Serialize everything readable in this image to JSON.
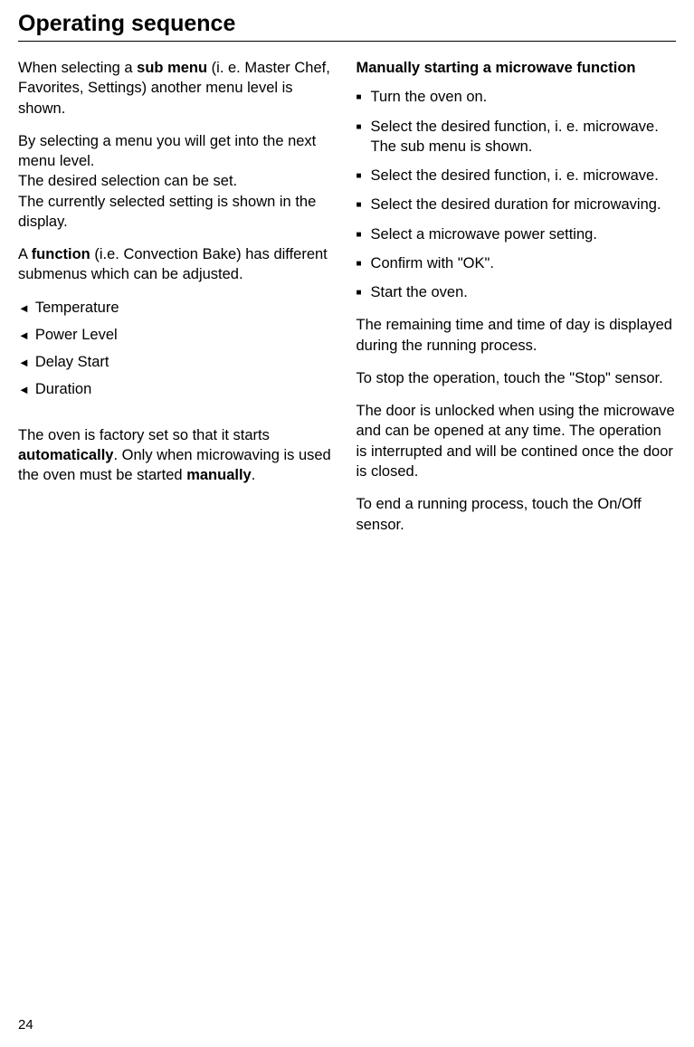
{
  "page": {
    "title": "Operating sequence",
    "number": "24"
  },
  "left": {
    "p1_a": "When selecting a ",
    "p1_bold": "sub menu",
    "p1_b": " (i. e. Master Chef, Favorites, Settings) another menu level is shown.",
    "p2": "By selecting a menu you will get into the next menu level.\nThe desired selection can be set.\nThe currently selected setting is shown in the display.",
    "p3_a": "A ",
    "p3_bold": "function",
    "p3_b": " (i.e. Convection Bake) has different submenus which can be adjusted.",
    "submenus": [
      "Temperature",
      "Power Level",
      "Delay Start",
      "Duration"
    ],
    "p4_a": "The oven is factory set so that it starts ",
    "p4_bold1": "automatically",
    "p4_b": ". Only when microwaving is used the oven must be started ",
    "p4_bold2": "manually",
    "p4_c": "."
  },
  "right": {
    "heading": "Manually starting a microwave function",
    "steps": [
      "Turn the oven on.",
      "Select the desired function, i. e. microwave. The sub menu is shown.",
      "Select the desired function, i. e. microwave.",
      "Select the desired duration for microwaving.",
      "Select a microwave power setting.",
      "Confirm with \"OK\".",
      "Start the oven."
    ],
    "p1": "The remaining time and time of day is displayed during the running process.",
    "p2": "To stop the operation, touch the \"Stop\" sensor.",
    "p3": "The door is unlocked when using the microwave and can be opened at any time. The operation is interrupted and will be contined once the door is closed.",
    "p4": "To end a running process, touch the On/Off sensor."
  }
}
